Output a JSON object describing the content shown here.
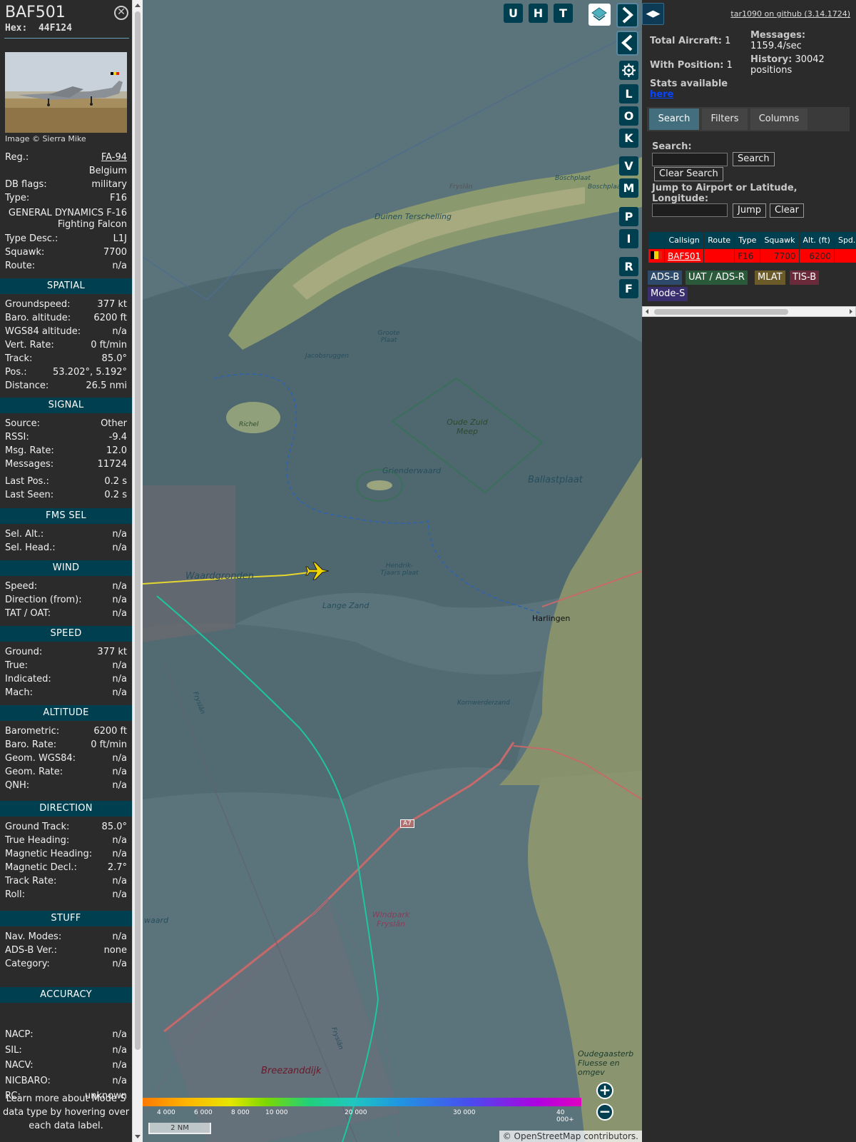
{
  "aircraft": {
    "callsign": "BAF501",
    "hex_label": "Hex:",
    "hex": "44F124",
    "photo_credit": "Image © Sierra Mike"
  },
  "info_rows": {
    "reg": {
      "label": "Reg.:",
      "value": "FA-94"
    },
    "country": "Belgium",
    "dbflags": {
      "label": "DB flags:",
      "value": "military"
    },
    "type": {
      "label": "Type:",
      "value": "F16"
    },
    "typename": "GENERAL DYNAMICS F-16 Fighting Falcon",
    "typedesc": {
      "label": "Type Desc.:",
      "value": "L1J"
    },
    "squawk": {
      "label": "Squawk:",
      "value": "7700"
    },
    "route": {
      "label": "Route:",
      "value": "n/a"
    }
  },
  "sections": {
    "spatial": {
      "title": "SPATIAL",
      "rows": [
        {
          "label": "Groundspeed:",
          "value": "377 kt"
        },
        {
          "label": "Baro. altitude:",
          "value": "6200 ft"
        },
        {
          "label": "WGS84 altitude:",
          "value": "n/a"
        },
        {
          "label": "Vert. Rate:",
          "value": "0 ft/min"
        },
        {
          "label": "Track:",
          "value": "85.0°"
        },
        {
          "label": "Pos.:",
          "value": "53.202°, 5.192°"
        },
        {
          "label": "Distance:",
          "value": "26.5 nmi"
        }
      ]
    },
    "signal": {
      "title": "SIGNAL",
      "rows": [
        {
          "label": "Source:",
          "value": "Other"
        },
        {
          "label": "RSSI:",
          "value": "-9.4"
        },
        {
          "label": "Msg. Rate:",
          "value": "12.0"
        },
        {
          "label": "Messages:",
          "value": "11724"
        },
        {
          "label": "Last Pos.:",
          "value": "0.2 s"
        },
        {
          "label": "Last Seen:",
          "value": "0.2 s"
        }
      ]
    },
    "fms": {
      "title": "FMS SEL",
      "rows": [
        {
          "label": "Sel. Alt.:",
          "value": "n/a"
        },
        {
          "label": "Sel. Head.:",
          "value": "n/a"
        }
      ]
    },
    "wind": {
      "title": "WIND",
      "rows": [
        {
          "label": "Speed:",
          "value": "n/a"
        },
        {
          "label": "Direction (from):",
          "value": "n/a"
        },
        {
          "label": "TAT / OAT:",
          "value": "n/a"
        }
      ]
    },
    "speed": {
      "title": "SPEED",
      "rows": [
        {
          "label": "Ground:",
          "value": "377 kt"
        },
        {
          "label": "True:",
          "value": "n/a"
        },
        {
          "label": "Indicated:",
          "value": "n/a"
        },
        {
          "label": "Mach:",
          "value": "n/a"
        }
      ]
    },
    "altitude": {
      "title": "ALTITUDE",
      "rows": [
        {
          "label": "Barometric:",
          "value": "6200 ft"
        },
        {
          "label": "Baro. Rate:",
          "value": "0 ft/min"
        },
        {
          "label": "Geom. WGS84:",
          "value": "n/a"
        },
        {
          "label": "Geom. Rate:",
          "value": "n/a"
        },
        {
          "label": "QNH:",
          "value": "n/a"
        }
      ]
    },
    "direction": {
      "title": "DIRECTION",
      "rows": [
        {
          "label": "Ground Track:",
          "value": "85.0°"
        },
        {
          "label": "True Heading:",
          "value": "n/a"
        },
        {
          "label": "Magnetic Heading:",
          "value": "n/a"
        },
        {
          "label": "Magnetic Decl.:",
          "value": "2.7°"
        },
        {
          "label": "Track Rate:",
          "value": "n/a"
        },
        {
          "label": "Roll:",
          "value": "n/a"
        }
      ]
    },
    "stuff": {
      "title": "STUFF",
      "rows": [
        {
          "label": "Nav. Modes:",
          "value": "n/a"
        },
        {
          "label": "ADS-B Ver.:",
          "value": "none"
        },
        {
          "label": "Category:",
          "value": "n/a"
        }
      ]
    },
    "accuracy": {
      "title": "ACCURACY",
      "rows": [
        {
          "label": "NACP:",
          "value": "n/a"
        },
        {
          "label": "SIL:",
          "value": "n/a"
        },
        {
          "label": "NACV:",
          "value": "n/a"
        },
        {
          "label": "NICBARO:",
          "value": "n/a"
        },
        {
          "label": "RC:",
          "value": "unknown"
        }
      ]
    }
  },
  "footer_note": "Learn more about Mode S data type by hovering over each data label.",
  "map": {
    "buttons": {
      "u": "U",
      "h": "H",
      "t": "T",
      "l": "L",
      "o": "O",
      "k": "K",
      "v": "V",
      "m": "M",
      "p": "P",
      "i": "I",
      "r": "R",
      "f": "F"
    },
    "labels": {
      "terschelling": "Duinen Terschelling",
      "boschplaat": "Boschplaat",
      "boschplaat2": "Boschplaat",
      "fryslan": "Fryslân",
      "groote_plaat": "Groote Plaat",
      "jacobsruggen": "Jacobsruggen",
      "richel": "Richel",
      "oude_zuid_meep": "Oude Zuid Meep",
      "grienderwaard": "Grienderwaard",
      "ballastplaat": "Ballastplaat",
      "waardgronden": "Waardgronden",
      "hendrik": "Hendrik-Tjaars plaat",
      "lange_zand": "Lange Zand",
      "harlingen": "Harlingen",
      "kornwerderzand": "Kornwerderzand",
      "a7": "A7",
      "windpark": "Windpark Fryslân",
      "breezanddijk": "Breezanddijk",
      "oudegaaster": "Oudegaasterb Fluesse en omgev",
      "waard": "waard",
      "fryslan2": "Fryslân",
      "fryslan3": "Fryslân"
    },
    "altitude_scale": [
      "4 000",
      "6 000",
      "8 000",
      "10 000",
      "20 000",
      "30 000",
      "40 000+"
    ],
    "scale": "2 NM",
    "attribution_copy": "© ",
    "attribution_link": "OpenStreetMap",
    "attribution_rest": " contributors."
  },
  "sidebar": {
    "github": "tar1090 on github (3.14.1724)",
    "total_aircraft_label": "Total Aircraft:",
    "total_aircraft": "1",
    "with_position_label": "With Position:",
    "with_position": "1",
    "messages_label": "Messages:",
    "messages": "1159.4/sec",
    "history_label": "History:",
    "history": "30042 positions",
    "stats_label": "Stats available",
    "stats_link": "here",
    "tabs": [
      "Search",
      "Filters",
      "Columns"
    ],
    "search_label": "Search:",
    "search_value": "",
    "search_button": "Search",
    "clear_search_button": "Clear Search",
    "jump_label": "Jump to Airport or Latitude, Longitude:",
    "jump_value": "",
    "jump_button": "Jump",
    "clear_button": "Clear",
    "table_headers": [
      "",
      "Callsign",
      "Route",
      "Type",
      "Squawk",
      "Alt. (ft)",
      "Spd."
    ],
    "table_rows": [
      {
        "callsign": "BAF501",
        "route": "",
        "type": "F16",
        "squawk": "7700",
        "alt": "6200",
        "spd": ""
      }
    ],
    "legend_chips": [
      {
        "label": "ADS-B",
        "color": "#2e4a6b"
      },
      {
        "label": "UAT / ADS-R",
        "color": "#2a5a3a"
      },
      {
        "label": "MLAT",
        "color": "#6b5a2a"
      },
      {
        "label": "TIS-B",
        "color": "#6b2a3a"
      },
      {
        "label": "Mode-S",
        "color": "#3a2f6e"
      }
    ]
  },
  "colors": {
    "panel": "#2b2b2b",
    "section": "#003f4f",
    "emergency_row": "#ff0000",
    "track": "#e6d630"
  }
}
